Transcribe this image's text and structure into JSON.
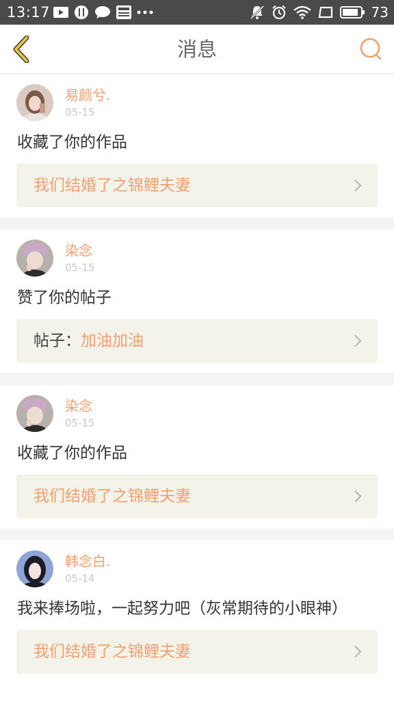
{
  "status_bar": {
    "time": "13:17",
    "battery": "73",
    "left_icons": [
      "youtube-icon",
      "app-icon",
      "chat-icon",
      "news-icon",
      "more-dots-icon"
    ],
    "right_icons": [
      "mute-icon",
      "alarm-icon",
      "wifi-icon",
      "screen-icon",
      "battery-icon"
    ]
  },
  "nav": {
    "title": "消息",
    "accent_color": "#f0a070",
    "back_color": "#e8c23c"
  },
  "messages": [
    {
      "user": "易颜兮.",
      "date": "05-15",
      "text": "收藏了你的作品",
      "link_prefix": "",
      "link_title": "我们结婚了之锦鲤夫妻"
    },
    {
      "user": "染念",
      "date": "05-15",
      "text": "赞了你的帖子",
      "link_prefix": "帖子：",
      "link_title": "加油加油"
    },
    {
      "user": "染念",
      "date": "05-15",
      "text": "收藏了你的作品",
      "link_prefix": "",
      "link_title": "我们结婚了之锦鲤夫妻"
    },
    {
      "user": "韩念白.",
      "date": "05-14",
      "text": "我来捧场啦，一起努力吧（灰常期待的小眼神）",
      "link_prefix": "",
      "link_title": "我们结婚了之锦鲤夫妻"
    }
  ]
}
